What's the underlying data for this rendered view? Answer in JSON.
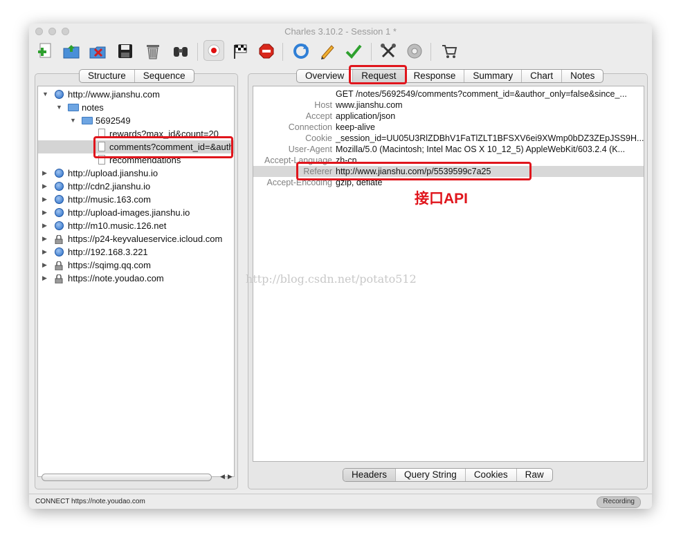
{
  "window": {
    "title": "Charles 3.10.2 - Session 1 *"
  },
  "toolbar": {
    "icons": [
      "new-session-icon",
      "open-session-icon",
      "clear-session-icon",
      "save-icon",
      "trash-icon",
      "find-icon",
      "record-icon",
      "throttle-flag-icon",
      "stop-icon",
      "refresh-icon",
      "edit-icon",
      "validate-icon",
      "tools-icon",
      "settings-icon",
      "shopping-cart-icon"
    ]
  },
  "left_tabs": [
    "Structure",
    "Sequence"
  ],
  "right_tabs": [
    "Overview",
    "Request",
    "Response",
    "Summary",
    "Chart",
    "Notes"
  ],
  "right_tabs_active": "Request",
  "tree": [
    {
      "label": "http://www.jianshu.com",
      "icon": "globe-icon",
      "expanded": true
    },
    {
      "label": "notes",
      "icon": "folder-icon",
      "expanded": true
    },
    {
      "label": "5692549",
      "icon": "folder-icon",
      "expanded": true
    },
    {
      "label": "rewards?max_id&count=20",
      "icon": "document-icon"
    },
    {
      "label": "comments?comment_id=&auth",
      "icon": "document-icon",
      "selected": true
    },
    {
      "label": "recommendations",
      "icon": "document-icon"
    },
    {
      "label": "http://upload.jianshu.io",
      "icon": "globe-icon"
    },
    {
      "label": "http://cdn2.jianshu.io",
      "icon": "globe-icon"
    },
    {
      "label": "http://music.163.com",
      "icon": "globe-icon"
    },
    {
      "label": "http://upload-images.jianshu.io",
      "icon": "globe-icon"
    },
    {
      "label": "http://m10.music.126.net",
      "icon": "globe-icon"
    },
    {
      "label": "https://p24-keyvalueservice.icloud.com",
      "icon": "lock-icon"
    },
    {
      "label": "http://192.168.3.221",
      "icon": "globe-icon"
    },
    {
      "label": "https://sqimg.qq.com",
      "icon": "lock-icon"
    },
    {
      "label": "https://note.youdao.com",
      "icon": "lock-icon"
    }
  ],
  "request": {
    "request_line": "GET /notes/5692549/comments?comment_id=&author_only=false&since_...",
    "headers": [
      {
        "key": "Host",
        "value": "www.jianshu.com"
      },
      {
        "key": "Accept",
        "value": "application/json"
      },
      {
        "key": "Connection",
        "value": "keep-alive"
      },
      {
        "key": "Cookie",
        "value": "_session_id=UU05U3RlZDBhV1FaTlZLT1BFSXV6ei9XWmp0bDZ3ZEpJSS9H..."
      },
      {
        "key": "User-Agent",
        "value": "Mozilla/5.0 (Macintosh; Intel Mac OS X 10_12_5) AppleWebKit/603.2.4 (K..."
      },
      {
        "key": "Accept-Language",
        "value": "zh-cn"
      },
      {
        "key": "Referer",
        "value": "http://www.jianshu.com/p/5539599c7a25"
      },
      {
        "key": "Accept-Encoding",
        "value": "gzip, deflate"
      }
    ]
  },
  "bottom_tabs": [
    "Headers",
    "Query String",
    "Cookies",
    "Raw"
  ],
  "annotation": "接口API",
  "watermark": "http://blog.csdn.net/potato512",
  "status": {
    "text": "CONNECT https://note.youdao.com",
    "recording": "Recording"
  },
  "colors": {
    "highlight": "#e0151c",
    "selection": "#d4d4d4"
  }
}
